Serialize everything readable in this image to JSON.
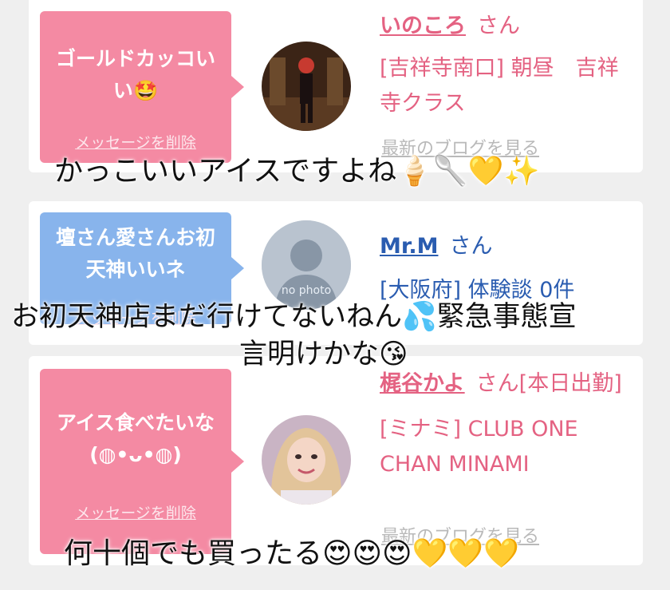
{
  "messages": [
    {
      "bubble_text": "ゴールドカッコいい",
      "bubble_emoji": "🤩",
      "delete_label": "メッセージを削除",
      "name": "いのころ",
      "honorific": "さん",
      "details": "[吉祥寺南口] 朝昼　吉祥寺クラス",
      "blog_link": "最新のブログを見る"
    },
    {
      "bubble_text": "壇さん愛さんお初天神いいネ",
      "delete_label": "メッセージを削除",
      "name": "Mr.M",
      "honorific": "さん",
      "details": "[大阪府] 体験談 0件",
      "avatar_label": "no photo"
    },
    {
      "bubble_text": "アイス食べたいな",
      "bubble_emoticon": "(◍•ᴗ•◍)",
      "delete_label": "メッセージを削除",
      "name": "梶谷かよ",
      "honorific": "さん[本日出勤]",
      "details": "[ミナミ] CLUB ONE CHAN MINAMI",
      "blog_link": "最新のブログを見る"
    }
  ],
  "captions": {
    "caption1": "かっこいいアイスですよね🍦🥄💛✨",
    "caption2_line1": "お初天神店まだ行けてないねん💦緊急事態宣",
    "caption2_line2": "言明けかな😘",
    "caption3": "何十個でも買ったる😍😍😍💛💛💛"
  },
  "colors": {
    "pink": "#f48aa3",
    "blue": "#88b4ec",
    "name_pink": "#e46282",
    "name_blue": "#2a5cb0"
  }
}
